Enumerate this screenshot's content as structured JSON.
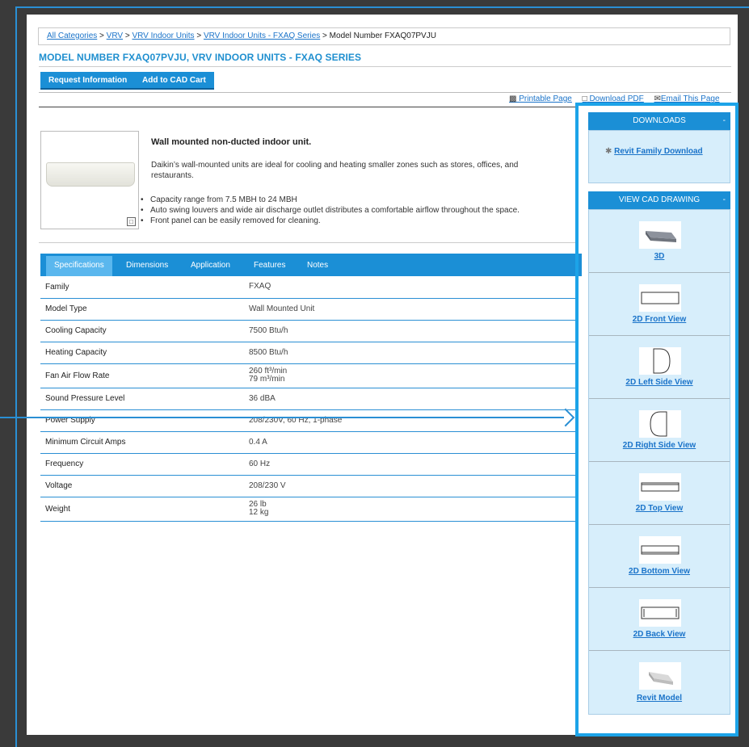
{
  "breadcrumb": {
    "items": [
      "All Categories",
      "VRV",
      "VRV Indoor Units",
      "VRV Indoor Units - FXAQ Series"
    ],
    "separator": ">",
    "current": "Model Number FXAQ07PVJU"
  },
  "page_title": "MODEL NUMBER FXAQ07PVJU, VRV INDOOR UNITS - FXAQ SERIES",
  "buttons": {
    "request": "Request Information",
    "cad_cart": "Add to CAD Cart"
  },
  "utilities": {
    "printable": "Printable Page",
    "pdf": "Download PDF",
    "email": "Email This Page"
  },
  "product": {
    "heading": "Wall mounted non-ducted indoor unit.",
    "description": "Daikin’s wall-mounted units are ideal for cooling and heating smaller zones such as stores, offices, and restaurants.",
    "bullets": [
      "Capacity range from 7.5 MBH to 24 MBH",
      "Auto swing louvers and wide air discharge outlet distributes a comfortable airflow throughout the space.",
      "Front panel can be easily removed for cleaning."
    ]
  },
  "tabs": [
    "Specifications",
    "Dimensions",
    "Application",
    "Features",
    "Notes"
  ],
  "specs": [
    {
      "name": "Family",
      "value": "FXAQ",
      "value2": ""
    },
    {
      "name": "Model Type",
      "value": "Wall Mounted Unit",
      "value2": ""
    },
    {
      "name": "Cooling Capacity",
      "value": "7500 Btu/h",
      "value2": ""
    },
    {
      "name": "Heating Capacity",
      "value": "8500 Btu/h",
      "value2": ""
    },
    {
      "name": "Fan Air Flow Rate",
      "value": "260 ft³/min",
      "value2": "79 m³/min"
    },
    {
      "name": "Sound Pressure Level",
      "value": "36 dBA",
      "value2": ""
    },
    {
      "name": "Power Supply",
      "value": "208/230V, 60 Hz, 1-phase",
      "value2": ""
    },
    {
      "name": "Minimum Circuit Amps",
      "value": "0.4 A",
      "value2": ""
    },
    {
      "name": "Frequency",
      "value": "60 Hz",
      "value2": ""
    },
    {
      "name": "Voltage",
      "value": "208/230 V",
      "value2": ""
    },
    {
      "name": "Weight",
      "value": "26 lb",
      "value2": "12 kg"
    }
  ],
  "sidebar": {
    "downloads_title": "DOWNLOADS",
    "downloads_item": "Revit Family Download",
    "cad_title": "VIEW CAD DRAWING",
    "collapse_symbol": "-",
    "cad_items": [
      "3D",
      "2D Front View",
      "2D Left Side View",
      "2D Right Side View",
      "2D Top View",
      "2D Bottom View",
      "2D Back View",
      "Revit Model"
    ]
  }
}
